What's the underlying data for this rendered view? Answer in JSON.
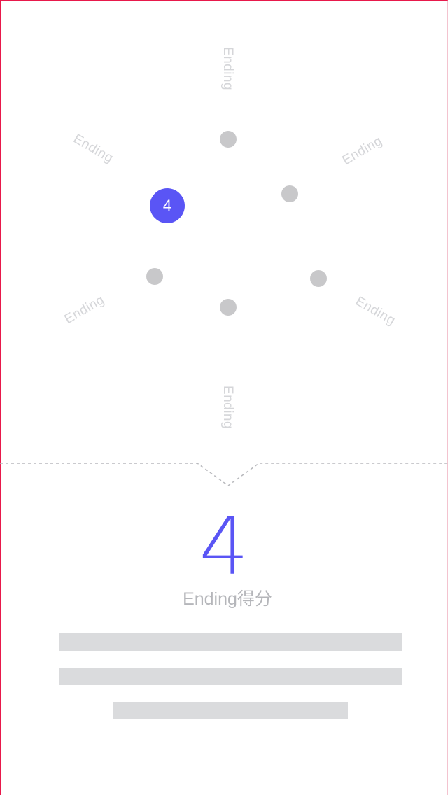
{
  "radial": {
    "axis_labels": [
      "Ending",
      "Ending",
      "Ending",
      "Ending",
      "Ending",
      "Ending"
    ],
    "selected_value": "4"
  },
  "score": {
    "value": "4",
    "label": "Ending得分"
  },
  "colors": {
    "accent": "#5a55f5",
    "dot": "#c8c8ca",
    "axis_label": "#d5d6d9",
    "placeholder": "#dadbdd",
    "frame": "#e8194b"
  }
}
